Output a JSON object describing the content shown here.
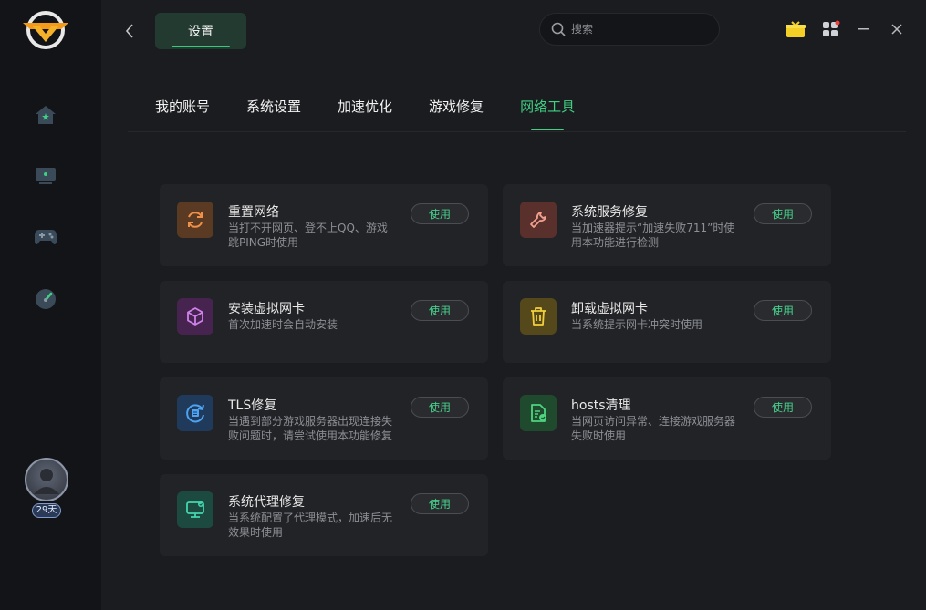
{
  "header": {
    "title": "设置",
    "search_placeholder": "搜索"
  },
  "user": {
    "days_badge": "29天"
  },
  "tabs": [
    {
      "label": "我的账号",
      "active": false
    },
    {
      "label": "系统设置",
      "active": false
    },
    {
      "label": "加速优化",
      "active": false
    },
    {
      "label": "游戏修复",
      "active": false
    },
    {
      "label": "网络工具",
      "active": true
    }
  ],
  "tools": [
    {
      "title": "重置网络",
      "desc": "当打不开网页、登不上QQ、游戏跳PING时使用",
      "button": "使用",
      "icon": "refresh-icon",
      "color": "#e0843a"
    },
    {
      "title": "系统服务修复",
      "desc": "当加速器提示“加速失败711”时使用本功能进行检测",
      "button": "使用",
      "icon": "wrench-icon",
      "color": "#e07a6a"
    },
    {
      "title": "安装虚拟网卡",
      "desc": "首次加速时会自动安装",
      "button": "使用",
      "icon": "cube-icon",
      "color": "#b46ad6"
    },
    {
      "title": "卸载虚拟网卡",
      "desc": "当系统提示网卡冲突时使用",
      "button": "使用",
      "icon": "trash-icon",
      "color": "#e0c030"
    },
    {
      "title": "TLS修复",
      "desc": "当遇到部分游戏服务器出现连接失败问题时，请尝试使用本功能修复",
      "button": "使用",
      "icon": "tls-icon",
      "color": "#3a8fe0"
    },
    {
      "title": "hosts清理",
      "desc": "当网页访问异常、连接游戏服务器失败时使用",
      "button": "使用",
      "icon": "file-clean-icon",
      "color": "#3fc36e"
    },
    {
      "title": "系统代理修复",
      "desc": "当系统配置了代理模式，加速后无效果时使用",
      "button": "使用",
      "icon": "monitor-icon",
      "color": "#35c7a0"
    }
  ]
}
